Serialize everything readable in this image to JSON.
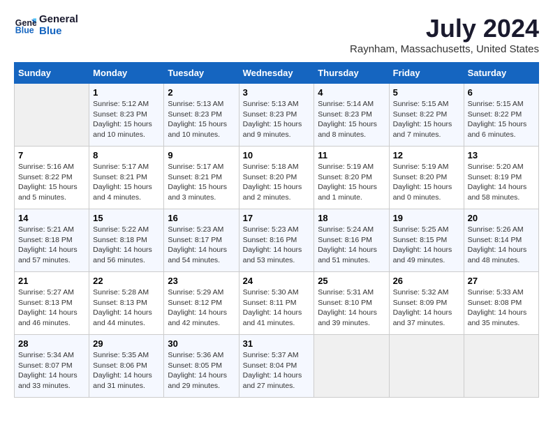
{
  "header": {
    "logo_line1": "General",
    "logo_line2": "Blue",
    "month": "July 2024",
    "location": "Raynham, Massachusetts, United States"
  },
  "weekdays": [
    "Sunday",
    "Monday",
    "Tuesday",
    "Wednesday",
    "Thursday",
    "Friday",
    "Saturday"
  ],
  "weeks": [
    [
      {
        "day": "",
        "empty": true
      },
      {
        "day": "1",
        "sunrise": "5:12 AM",
        "sunset": "8:23 PM",
        "daylight": "15 hours and 10 minutes."
      },
      {
        "day": "2",
        "sunrise": "5:13 AM",
        "sunset": "8:23 PM",
        "daylight": "15 hours and 10 minutes."
      },
      {
        "day": "3",
        "sunrise": "5:13 AM",
        "sunset": "8:23 PM",
        "daylight": "15 hours and 9 minutes."
      },
      {
        "day": "4",
        "sunrise": "5:14 AM",
        "sunset": "8:23 PM",
        "daylight": "15 hours and 8 minutes."
      },
      {
        "day": "5",
        "sunrise": "5:15 AM",
        "sunset": "8:22 PM",
        "daylight": "15 hours and 7 minutes."
      },
      {
        "day": "6",
        "sunrise": "5:15 AM",
        "sunset": "8:22 PM",
        "daylight": "15 hours and 6 minutes."
      }
    ],
    [
      {
        "day": "7",
        "sunrise": "5:16 AM",
        "sunset": "8:22 PM",
        "daylight": "15 hours and 5 minutes."
      },
      {
        "day": "8",
        "sunrise": "5:17 AM",
        "sunset": "8:21 PM",
        "daylight": "15 hours and 4 minutes."
      },
      {
        "day": "9",
        "sunrise": "5:17 AM",
        "sunset": "8:21 PM",
        "daylight": "15 hours and 3 minutes."
      },
      {
        "day": "10",
        "sunrise": "5:18 AM",
        "sunset": "8:20 PM",
        "daylight": "15 hours and 2 minutes."
      },
      {
        "day": "11",
        "sunrise": "5:19 AM",
        "sunset": "8:20 PM",
        "daylight": "15 hours and 1 minute."
      },
      {
        "day": "12",
        "sunrise": "5:19 AM",
        "sunset": "8:20 PM",
        "daylight": "15 hours and 0 minutes."
      },
      {
        "day": "13",
        "sunrise": "5:20 AM",
        "sunset": "8:19 PM",
        "daylight": "14 hours and 58 minutes."
      }
    ],
    [
      {
        "day": "14",
        "sunrise": "5:21 AM",
        "sunset": "8:18 PM",
        "daylight": "14 hours and 57 minutes."
      },
      {
        "day": "15",
        "sunrise": "5:22 AM",
        "sunset": "8:18 PM",
        "daylight": "14 hours and 56 minutes."
      },
      {
        "day": "16",
        "sunrise": "5:23 AM",
        "sunset": "8:17 PM",
        "daylight": "14 hours and 54 minutes."
      },
      {
        "day": "17",
        "sunrise": "5:23 AM",
        "sunset": "8:16 PM",
        "daylight": "14 hours and 53 minutes."
      },
      {
        "day": "18",
        "sunrise": "5:24 AM",
        "sunset": "8:16 PM",
        "daylight": "14 hours and 51 minutes."
      },
      {
        "day": "19",
        "sunrise": "5:25 AM",
        "sunset": "8:15 PM",
        "daylight": "14 hours and 49 minutes."
      },
      {
        "day": "20",
        "sunrise": "5:26 AM",
        "sunset": "8:14 PM",
        "daylight": "14 hours and 48 minutes."
      }
    ],
    [
      {
        "day": "21",
        "sunrise": "5:27 AM",
        "sunset": "8:13 PM",
        "daylight": "14 hours and 46 minutes."
      },
      {
        "day": "22",
        "sunrise": "5:28 AM",
        "sunset": "8:13 PM",
        "daylight": "14 hours and 44 minutes."
      },
      {
        "day": "23",
        "sunrise": "5:29 AM",
        "sunset": "8:12 PM",
        "daylight": "14 hours and 42 minutes."
      },
      {
        "day": "24",
        "sunrise": "5:30 AM",
        "sunset": "8:11 PM",
        "daylight": "14 hours and 41 minutes."
      },
      {
        "day": "25",
        "sunrise": "5:31 AM",
        "sunset": "8:10 PM",
        "daylight": "14 hours and 39 minutes."
      },
      {
        "day": "26",
        "sunrise": "5:32 AM",
        "sunset": "8:09 PM",
        "daylight": "14 hours and 37 minutes."
      },
      {
        "day": "27",
        "sunrise": "5:33 AM",
        "sunset": "8:08 PM",
        "daylight": "14 hours and 35 minutes."
      }
    ],
    [
      {
        "day": "28",
        "sunrise": "5:34 AM",
        "sunset": "8:07 PM",
        "daylight": "14 hours and 33 minutes."
      },
      {
        "day": "29",
        "sunrise": "5:35 AM",
        "sunset": "8:06 PM",
        "daylight": "14 hours and 31 minutes."
      },
      {
        "day": "30",
        "sunrise": "5:36 AM",
        "sunset": "8:05 PM",
        "daylight": "14 hours and 29 minutes."
      },
      {
        "day": "31",
        "sunrise": "5:37 AM",
        "sunset": "8:04 PM",
        "daylight": "14 hours and 27 minutes."
      },
      {
        "day": "",
        "empty": true
      },
      {
        "day": "",
        "empty": true
      },
      {
        "day": "",
        "empty": true
      }
    ]
  ],
  "labels": {
    "sunrise_prefix": "Sunrise: ",
    "sunset_prefix": "Sunset: ",
    "daylight_prefix": "Daylight: "
  }
}
